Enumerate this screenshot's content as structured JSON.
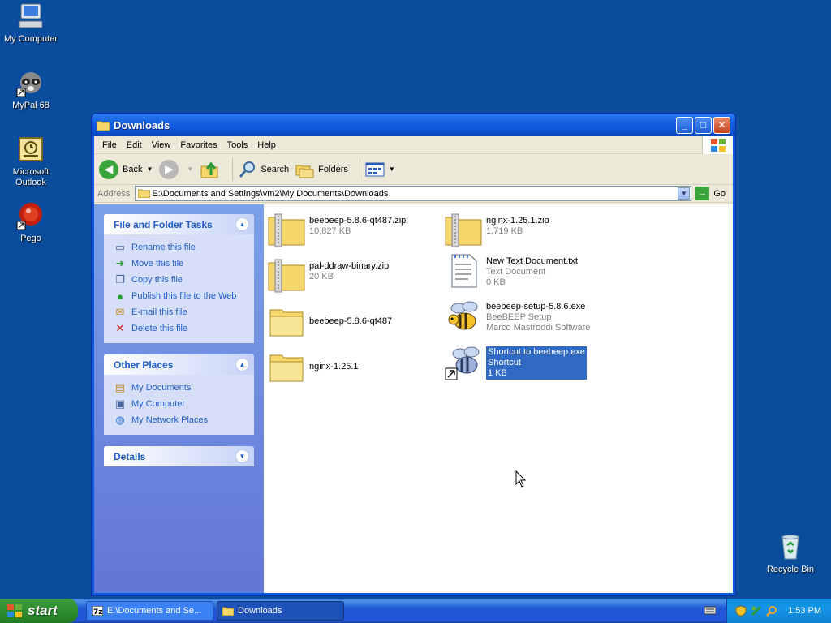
{
  "desktop": {
    "icons": [
      {
        "label": "My Computer"
      },
      {
        "label": "MyPal 68"
      },
      {
        "label": "Microsoft Outlook"
      },
      {
        "label": "Pego"
      },
      {
        "label": "Recycle Bin"
      }
    ]
  },
  "window": {
    "title": "Downloads",
    "menu": [
      "File",
      "Edit",
      "View",
      "Favorites",
      "Tools",
      "Help"
    ],
    "toolbar": {
      "back": "Back",
      "search": "Search",
      "folders": "Folders"
    },
    "address": {
      "label": "Address",
      "value": "E:\\Documents and Settings\\vm2\\My Documents\\Downloads",
      "go": "Go"
    }
  },
  "taskpane": {
    "file_tasks": {
      "title": "File and Folder Tasks",
      "items": [
        "Rename this file",
        "Move this file",
        "Copy this file",
        "Publish this file to the Web",
        "E-mail this file",
        "Delete this file"
      ]
    },
    "other_places": {
      "title": "Other Places",
      "items": [
        "My Documents",
        "My Computer",
        "My Network Places"
      ]
    },
    "details": {
      "title": "Details"
    }
  },
  "files": [
    {
      "name": "beebeep-5.8.6-qt487.zip",
      "line2": "10,827 KB",
      "line3": ""
    },
    {
      "name": "nginx-1.25.1.zip",
      "line2": "1,719 KB",
      "line3": ""
    },
    {
      "name": "pal-ddraw-binary.zip",
      "line2": "20 KB",
      "line3": ""
    },
    {
      "name": "New Text Document.txt",
      "line2": "Text Document",
      "line3": "0 KB"
    },
    {
      "name": "beebeep-5.8.6-qt487",
      "line2": "",
      "line3": ""
    },
    {
      "name": "beebeep-setup-5.8.6.exe",
      "line2": "BeeBEEP Setup",
      "line3": "Marco Mastroddi Software"
    },
    {
      "name": "nginx-1.25.1",
      "line2": "",
      "line3": ""
    },
    {
      "name": "Shortcut to beebeep.exe",
      "line2": "Shortcut",
      "line3": "1 KB"
    }
  ],
  "taskbar": {
    "start": "start",
    "tasks": [
      "E:\\Documents and Se...",
      "Downloads"
    ],
    "clock": "1:53 PM"
  }
}
